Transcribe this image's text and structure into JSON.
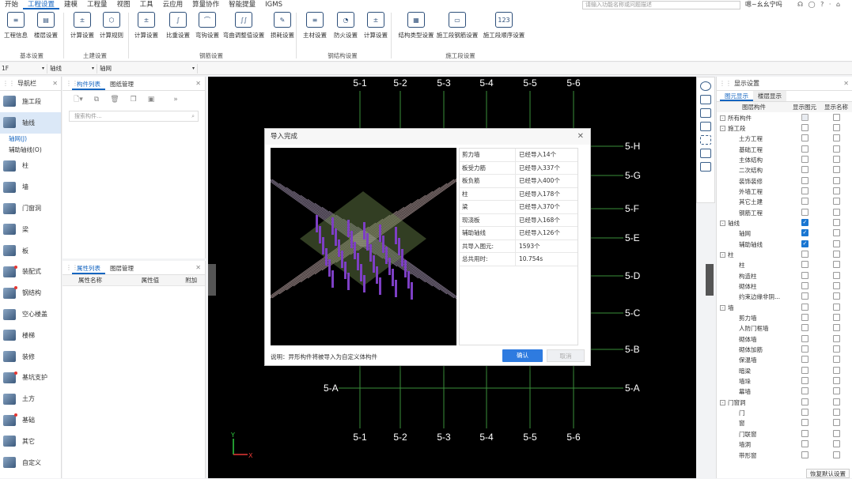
{
  "menu": [
    "开始",
    "工程设置",
    "建模",
    "工程量",
    "视图",
    "工具",
    "云应用",
    "算量协作",
    "智能提量",
    "IGMS"
  ],
  "menu_active": 1,
  "search_placeholder": "请输入功能名称或问题描述",
  "user": "嗯~幺幺宁吗",
  "top_icons": "☊ ◯ ? · ⌂",
  "ribbon": {
    "buttons": [
      {
        "label": "工程信息",
        "glyph": "≡"
      },
      {
        "label": "楼层设置",
        "glyph": "▤"
      },
      {
        "label": "计算设置",
        "glyph": "±"
      },
      {
        "label": "计算规则",
        "glyph": "⬡"
      },
      {
        "label": "计算设置",
        "glyph": "±"
      },
      {
        "label": "比重设置",
        "glyph": "∫"
      },
      {
        "label": "弯钩设置",
        "glyph": "⌒"
      },
      {
        "label": "弯曲调整值设置",
        "glyph": "∫∫"
      },
      {
        "label": "损耗设置",
        "glyph": "✎"
      },
      {
        "label": "主材设置",
        "glyph": "≡"
      },
      {
        "label": "防火设置",
        "glyph": "◔"
      },
      {
        "label": "计算设置",
        "glyph": "±"
      },
      {
        "label": "结构类型设置",
        "glyph": "▦"
      },
      {
        "label": "施工段钢筋设置",
        "glyph": "▭"
      },
      {
        "label": "施工段顺序设置",
        "glyph": "123"
      }
    ],
    "groups": [
      "基本设置",
      "土建设置",
      "钢筋设置",
      "钢结构设置",
      "施工段设置"
    ]
  },
  "subbar": {
    "floor": "1F",
    "type": "轴线",
    "name": "轴网"
  },
  "nav": {
    "title": "导航栏",
    "items": [
      {
        "label": "施工段",
        "dot": false
      },
      {
        "label": "轴线",
        "dot": false,
        "active": true
      }
    ],
    "sub": [
      "轴网(J)",
      "辅助轴线(O)"
    ],
    "items2": [
      {
        "label": "柱",
        "dot": false
      },
      {
        "label": "墙",
        "dot": false
      },
      {
        "label": "门窗洞",
        "dot": false
      },
      {
        "label": "梁",
        "dot": false
      },
      {
        "label": "板",
        "dot": false
      },
      {
        "label": "装配式",
        "dot": true
      },
      {
        "label": "钢结构",
        "dot": true
      },
      {
        "label": "空心楼盖",
        "dot": false
      },
      {
        "label": "楼梯",
        "dot": false
      },
      {
        "label": "装修",
        "dot": false
      },
      {
        "label": "基坑支护",
        "dot": true
      },
      {
        "label": "土方",
        "dot": false
      },
      {
        "label": "基础",
        "dot": true
      },
      {
        "label": "其它",
        "dot": false
      },
      {
        "label": "自定义",
        "dot": false
      }
    ]
  },
  "comp": {
    "tabs": [
      "构件列表",
      "图纸管理"
    ],
    "search": "搜索构件..."
  },
  "prop": {
    "tabs": [
      "属性列表",
      "图层管理"
    ],
    "cols": [
      "属性名称",
      "属性值",
      "附加"
    ]
  },
  "axes": {
    "top": [
      "5-1",
      "5-2",
      "5-3",
      "5-4",
      "5-5",
      "5-6"
    ],
    "bottom": [
      "5-1",
      "5-2",
      "5-3",
      "5-4",
      "5-5",
      "5-6"
    ],
    "right": [
      "5-H",
      "5-G",
      "5-F",
      "5-E",
      "5-D",
      "5-C",
      "5-B",
      "5-A"
    ],
    "left": [
      "5-A"
    ]
  },
  "dialog": {
    "title": "导入完成",
    "rows": [
      {
        "k": "剪力墙",
        "v": "已经导入14个"
      },
      {
        "k": "板受力筋",
        "v": "已经导入337个"
      },
      {
        "k": "板负筋",
        "v": "已经导入400个"
      },
      {
        "k": "柱",
        "v": "已经导入178个"
      },
      {
        "k": "梁",
        "v": "已经导入370个"
      },
      {
        "k": "现浇板",
        "v": "已经导入168个"
      },
      {
        "k": "辅助轴线",
        "v": "已经导入126个"
      },
      {
        "k": "共导入图元:",
        "v": "1593个"
      },
      {
        "k": "总共用时:",
        "v": "10.754s"
      }
    ],
    "note": "说明：异形构件将被导入为自定义体构件",
    "ok": "确认",
    "cancel": "取消"
  },
  "display": {
    "title": "显示设置",
    "tabs": [
      "图元显示",
      "楼层显示"
    ],
    "cols": [
      "图层构件",
      "显示图元",
      "显示名称"
    ],
    "rows": [
      {
        "n": "所有构件",
        "lvl": 0,
        "exp": "-",
        "a": "gray",
        "b": "off"
      },
      {
        "n": "施工段",
        "lvl": 0,
        "exp": "-",
        "a": "off",
        "b": "off"
      },
      {
        "n": "土方工程",
        "lvl": 1,
        "a": "off",
        "b": "off"
      },
      {
        "n": "基础工程",
        "lvl": 1,
        "a": "off",
        "b": "off"
      },
      {
        "n": "主体结构",
        "lvl": 1,
        "a": "off",
        "b": "off"
      },
      {
        "n": "二次结构",
        "lvl": 1,
        "a": "off",
        "b": "off"
      },
      {
        "n": "装饰装修",
        "lvl": 1,
        "a": "off",
        "b": "off"
      },
      {
        "n": "外墙工程",
        "lvl": 1,
        "a": "off",
        "b": "off"
      },
      {
        "n": "其它土建",
        "lvl": 1,
        "a": "off",
        "b": "off"
      },
      {
        "n": "钢筋工程",
        "lvl": 1,
        "a": "off",
        "b": "off"
      },
      {
        "n": "轴线",
        "lvl": 0,
        "exp": "-",
        "a": "on",
        "b": "off"
      },
      {
        "n": "轴网",
        "lvl": 1,
        "a": "on",
        "b": "off"
      },
      {
        "n": "辅助轴线",
        "lvl": 1,
        "a": "on",
        "b": "off"
      },
      {
        "n": "柱",
        "lvl": 0,
        "exp": "-",
        "a": "off",
        "b": "off"
      },
      {
        "n": "柱",
        "lvl": 1,
        "a": "off",
        "b": "off"
      },
      {
        "n": "构造柱",
        "lvl": 1,
        "a": "off",
        "b": "off"
      },
      {
        "n": "砌体柱",
        "lvl": 1,
        "a": "off",
        "b": "off"
      },
      {
        "n": "约束边缘非阴...",
        "lvl": 1,
        "a": "off",
        "b": "off"
      },
      {
        "n": "墙",
        "lvl": 0,
        "exp": "-",
        "a": "off",
        "b": "off"
      },
      {
        "n": "剪力墙",
        "lvl": 1,
        "a": "off",
        "b": "off"
      },
      {
        "n": "人防门框墙",
        "lvl": 1,
        "a": "off",
        "b": "off"
      },
      {
        "n": "砌体墙",
        "lvl": 1,
        "a": "off",
        "b": "off"
      },
      {
        "n": "砌体加筋",
        "lvl": 1,
        "a": "off",
        "b": "off"
      },
      {
        "n": "保温墙",
        "lvl": 1,
        "a": "off",
        "b": "off"
      },
      {
        "n": "暗梁",
        "lvl": 1,
        "a": "off",
        "b": "off"
      },
      {
        "n": "墙垛",
        "lvl": 1,
        "a": "off",
        "b": "off"
      },
      {
        "n": "幕墙",
        "lvl": 1,
        "a": "off",
        "b": "off"
      },
      {
        "n": "门窗洞",
        "lvl": 0,
        "exp": "-",
        "a": "off",
        "b": "off"
      },
      {
        "n": "门",
        "lvl": 1,
        "a": "off",
        "b": "off"
      },
      {
        "n": "窗",
        "lvl": 1,
        "a": "off",
        "b": "off"
      },
      {
        "n": "门联窗",
        "lvl": 1,
        "a": "off",
        "b": "off"
      },
      {
        "n": "墙洞",
        "lvl": 1,
        "a": "off",
        "b": "off"
      },
      {
        "n": "带形窗",
        "lvl": 1,
        "a": "off",
        "b": "off"
      }
    ],
    "restore": "恢复默认设置"
  }
}
